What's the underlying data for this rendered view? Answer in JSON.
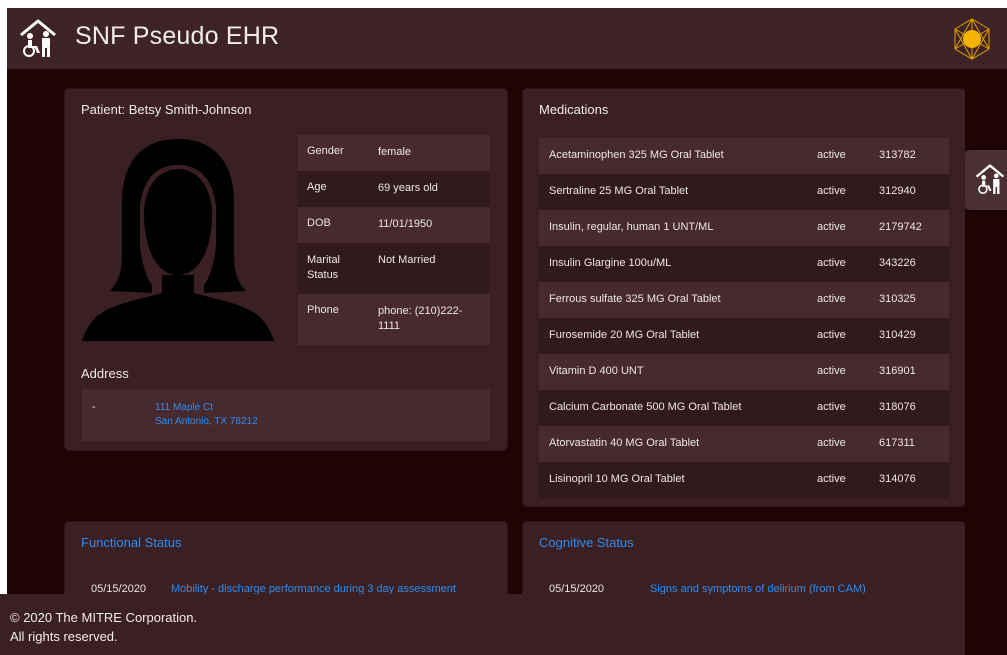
{
  "header": {
    "title": "SNF Pseudo EHR"
  },
  "patient": {
    "heading": "Patient: Betsy Smith-Johnson",
    "fields": [
      {
        "label": "Gender",
        "value": "female"
      },
      {
        "label": "Age",
        "value": "69 years old"
      },
      {
        "label": "DOB",
        "value": "11/01/1950"
      },
      {
        "label": "Marital Status",
        "value": "Not Married"
      },
      {
        "label": "Phone",
        "value": "phone: (210)222-1111"
      }
    ],
    "address_heading": "Address",
    "address_dash": "-",
    "address_line1": "111 Maple Ct",
    "address_line2": "San Antonio, TX 78212"
  },
  "medications": {
    "heading": "Medications",
    "rows": [
      {
        "name": "Acetaminophen 325 MG Oral Tablet",
        "status": "active",
        "code": "313782"
      },
      {
        "name": "Sertraline 25 MG Oral Tablet",
        "status": "active",
        "code": "312940"
      },
      {
        "name": "Insulin, regular, human 1 UNT/ML",
        "status": "active",
        "code": "2179742"
      },
      {
        "name": "Insulin Glargine 100u/ML",
        "status": "active",
        "code": "343226"
      },
      {
        "name": "Ferrous sulfate 325 MG Oral Tablet",
        "status": "active",
        "code": "310325"
      },
      {
        "name": "Furosemide 20 MG Oral Tablet",
        "status": "active",
        "code": "310429"
      },
      {
        "name": "Vitamin D 400 UNT",
        "status": "active",
        "code": "316901"
      },
      {
        "name": "Calcium Carbonate 500 MG Oral Tablet",
        "status": "active",
        "code": "318076"
      },
      {
        "name": "Atorvastatin 40 MG Oral Tablet",
        "status": "active",
        "code": "617311"
      },
      {
        "name": "Lisinopril 10 MG Oral Tablet",
        "status": "active",
        "code": "314076"
      }
    ]
  },
  "functional": {
    "heading": "Functional Status",
    "date": "05/15/2020",
    "item": "Mobility - discharge performance during 3 day assessment"
  },
  "cognitive": {
    "heading": "Cognitive Status",
    "date": "05/15/2020",
    "item": "Signs and symptoms of delirium (from CAM)"
  },
  "footer": {
    "line1": "© 2020 The MITRE Corporation.",
    "line2": "All rights reserved."
  },
  "icons": {
    "app_logo": "home-care-icon",
    "brand": "network-hexagon-icon",
    "side_tab": "home-care-icon"
  },
  "colors": {
    "background": "#1f0406",
    "panel": "#3a2022",
    "link": "#2e8bf0",
    "brand_accent": "#f5b400"
  }
}
